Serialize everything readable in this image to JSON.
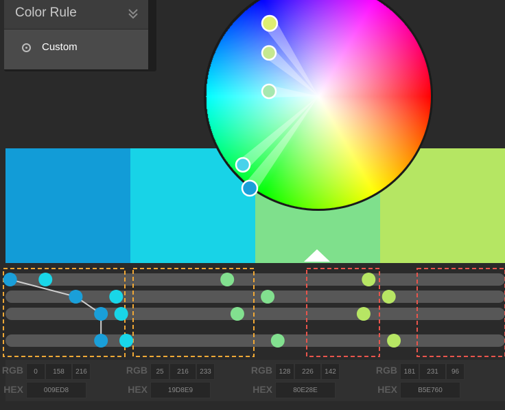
{
  "color_rule": {
    "title": "Color Rule",
    "option_label": "Custom"
  },
  "colors": [
    {
      "hex_display": "009ED8",
      "fill": "#129cd7",
      "rgb": [
        "0",
        "158",
        "216"
      ],
      "sliders": [
        0.02,
        0.15,
        0.2,
        0.2
      ],
      "dot": "#1a9fd9"
    },
    {
      "hex_display": "19D8E9",
      "fill": "#18d3e7",
      "rgb": [
        "25",
        "216",
        "233"
      ],
      "sliders": [
        0.09,
        0.23,
        0.24,
        0.25
      ],
      "dot": "#19d6e8"
    },
    {
      "hex_display": "80E28E",
      "fill": "#7fe08c",
      "rgb": [
        "128",
        "226",
        "142"
      ],
      "sliders": [
        0.45,
        0.53,
        0.47,
        0.55
      ],
      "dot": "#82e08f"
    },
    {
      "hex_display": "B5E760",
      "fill": "#b5e663",
      "rgb": [
        "181",
        "231",
        "96"
      ],
      "sliders": [
        0.73,
        0.77,
        0.72,
        0.78
      ],
      "dot": "#b7e664"
    }
  ],
  "labels": {
    "rgb": "RGB",
    "hex": "HEX"
  }
}
